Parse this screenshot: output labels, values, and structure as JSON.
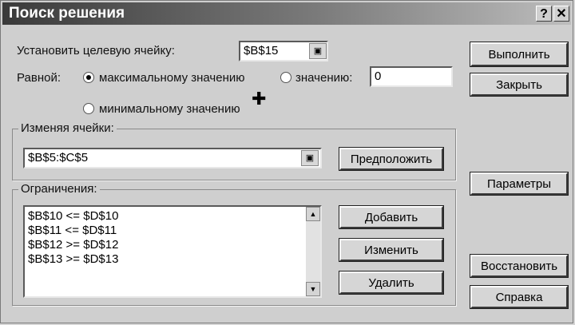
{
  "window": {
    "title": "Поиск решения",
    "help_btn": "?",
    "close_btn": "✕"
  },
  "target": {
    "label": "Установить целевую ячейку:",
    "value": "$B$15"
  },
  "equal": {
    "label": "Равной:",
    "max_label": "максимальному значению",
    "value_label": "значению:",
    "value_input": "0",
    "min_label": "минимальному значению",
    "selected": "max"
  },
  "changing": {
    "group_label": "Изменяя ячейки:",
    "value": "$B$5:$C$5",
    "guess_label": "Предположить"
  },
  "constraints": {
    "group_label": "Ограничения:",
    "items": [
      "$B$10 <= $D$10",
      "$B$11 <= $D$11",
      "$B$12 >= $D$12",
      "$B$13 >= $D$13"
    ],
    "add_label": "Добавить",
    "change_label": "Изменить",
    "delete_label": "Удалить"
  },
  "side_buttons": {
    "solve": "Выполнить",
    "close": "Закрыть",
    "options": "Параметры",
    "reset": "Восстановить",
    "help": "Справка"
  }
}
